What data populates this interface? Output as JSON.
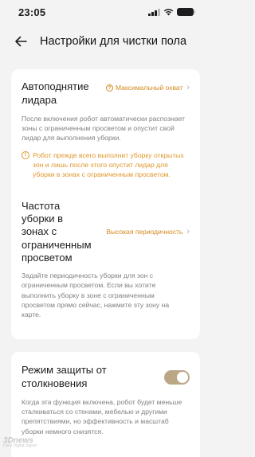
{
  "status_bar": {
    "time": "23:05"
  },
  "header": {
    "title": "Настройки для чистки пола"
  },
  "lidar": {
    "title": "Автоподнятие лидара",
    "value": "Максимальный охват",
    "description": "После включения робот автоматически распознает зоны с ограниченным просветом и опустит свой лидар для выполнения уборки.",
    "warning": "Робот прежде всего выполнит уборку открытых зон и лишь после этого опустит лидар для уборки в зонах с ограниченным просветом."
  },
  "frequency": {
    "title": "Частота уборки в зонах с ограниченным просветом",
    "value": "Высокая периодичность",
    "description": "Задайте периодичность уборки для зон с ограниченным просветом. Если вы хотите выполнить уборку в зоне с ограниченным просветом прямо сейчас, нажмите эту зону на карте."
  },
  "collision": {
    "title": "Режим защиты от столкновения",
    "enabled": true,
    "description": "Когда эта функция включена, робот будет меньше сталкиваться со стенами, мебелью и другими препятствиями, но эффективность и масштаб уборки немного снизятся."
  },
  "watermark": {
    "main": "3Dnews",
    "sub": "Daily Digital Digest"
  },
  "colors": {
    "accent": "#d28a1e",
    "warning": "#e0962a",
    "toggle_on": "#bba686"
  }
}
